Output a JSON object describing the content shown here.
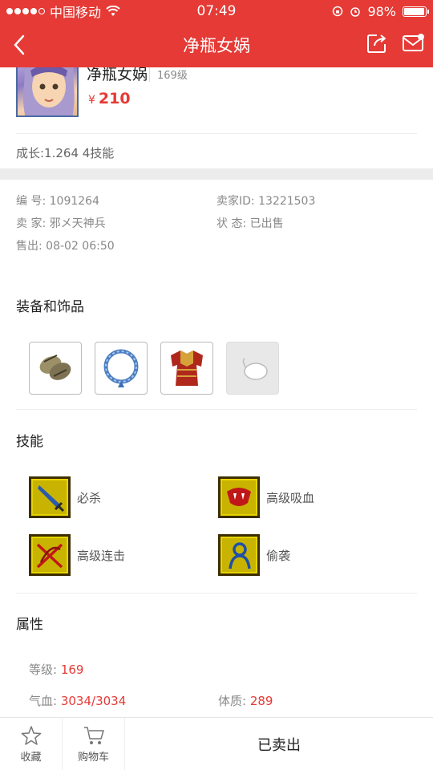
{
  "status_bar": {
    "carrier": "中国移动",
    "time": "07:49",
    "battery": "98%",
    "battery_level": 0.98
  },
  "nav": {
    "title": "净瓶女娲",
    "back_icon": "chevron-left-icon",
    "share_icon": "share-icon",
    "mail_icon": "mail-icon"
  },
  "pet": {
    "name": "净瓶女娲",
    "level": "169级",
    "price_symbol": "¥",
    "price": "210",
    "growth": "成长:1.264 4技能"
  },
  "info": {
    "id_label": "编   号:",
    "id": "1091264",
    "seller_id_label": "卖家ID:",
    "seller_id": "13221503",
    "seller_label": "卖   家:",
    "seller": "邪メ天神兵",
    "state_label": "状   态:",
    "state": "已出售",
    "sold_label": "售出:",
    "sold_time": "08-02 06:50"
  },
  "sections": {
    "equipment": "装备和饰品",
    "skills": "技能",
    "attributes": "属性"
  },
  "equipment": [
    {
      "icon": "bracers-icon"
    },
    {
      "icon": "necklace-icon"
    },
    {
      "icon": "armor-icon"
    },
    {
      "icon": "empty-accessory-slot-icon"
    }
  ],
  "skills": [
    {
      "name": "必杀",
      "icon": "sword-skill-icon"
    },
    {
      "name": "高级吸血",
      "icon": "fang-skill-icon"
    },
    {
      "name": "高级连击",
      "icon": "cross-slash-skill-icon"
    },
    {
      "name": "偷袭",
      "icon": "sneak-attack-skill-icon"
    }
  ],
  "attributes": {
    "level_label": "等级:",
    "level": "169",
    "hp_label": "气血:",
    "hp": "3034/3034",
    "con_label": "体质:",
    "con": "289"
  },
  "bottom": {
    "favorite": "收藏",
    "cart": "购物车",
    "action": "已卖出"
  },
  "colors": {
    "accent": "#e53a35",
    "value_red": "#e53a35",
    "skill_bg": "#c8b400"
  }
}
